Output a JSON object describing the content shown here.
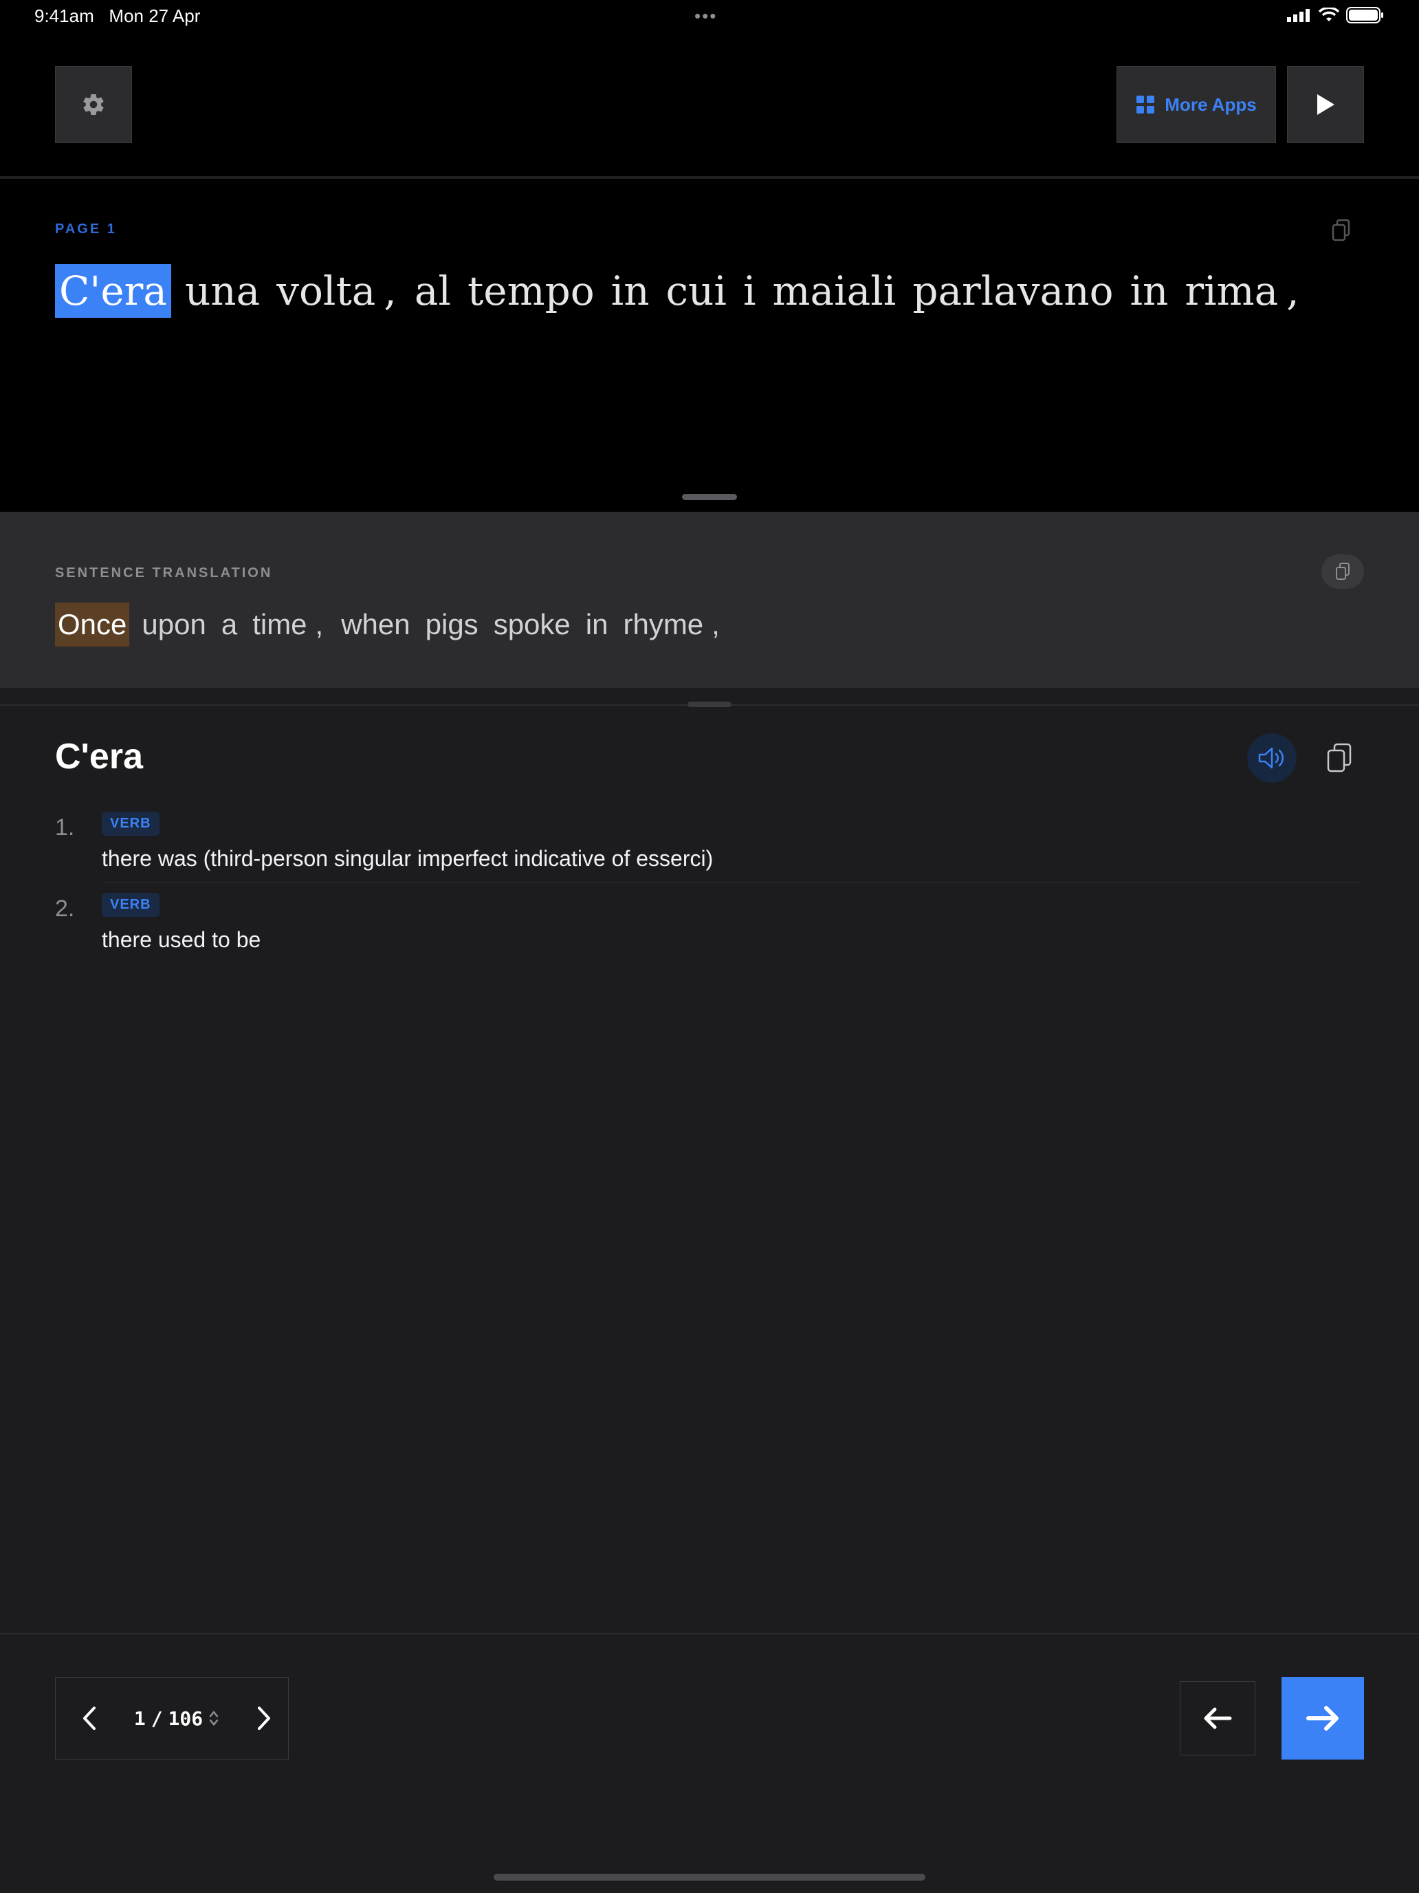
{
  "status_bar": {
    "time": "9:41am",
    "date": "Mon 27 Apr",
    "dots": "•••"
  },
  "toolbar": {
    "settings_icon": "gear-icon",
    "more_apps_label": "More Apps",
    "play_icon": "play-icon"
  },
  "page": {
    "label": "PAGE 1",
    "words": [
      {
        "text": "C'era",
        "selected": true
      },
      {
        "text": "una"
      },
      {
        "text": "volta"
      },
      {
        "text": ",",
        "punct": true
      },
      {
        "text": "al"
      },
      {
        "text": "tempo"
      },
      {
        "text": "in"
      },
      {
        "text": "cui"
      },
      {
        "text": "i"
      },
      {
        "text": "maiali"
      },
      {
        "text": "parlavano"
      },
      {
        "text": "in"
      },
      {
        "text": "rima"
      },
      {
        "text": ",",
        "punct": true
      }
    ]
  },
  "translation": {
    "label": "SENTENCE TRANSLATION",
    "words": [
      {
        "text": "Once",
        "selected": true
      },
      {
        "text": "upon"
      },
      {
        "text": "a"
      },
      {
        "text": "time"
      },
      {
        "text": ",",
        "punct": true
      },
      {
        "text": "when"
      },
      {
        "text": "pigs"
      },
      {
        "text": "spoke"
      },
      {
        "text": "in"
      },
      {
        "text": "rhyme"
      },
      {
        "text": ",",
        "punct": true
      }
    ]
  },
  "dictionary": {
    "word": "C'era",
    "definitions": [
      {
        "number": "1.",
        "pos": "VERB",
        "text": "there was (third-person singular imperfect indicative of esserci)"
      },
      {
        "number": "2.",
        "pos": "VERB",
        "text": "there used to be"
      }
    ]
  },
  "pager": {
    "current": "1",
    "separator": "/",
    "total": "106"
  },
  "colors": {
    "accent": "#3b82f6",
    "translation_highlight": "#5b4026",
    "background": "#1c1c1e"
  }
}
